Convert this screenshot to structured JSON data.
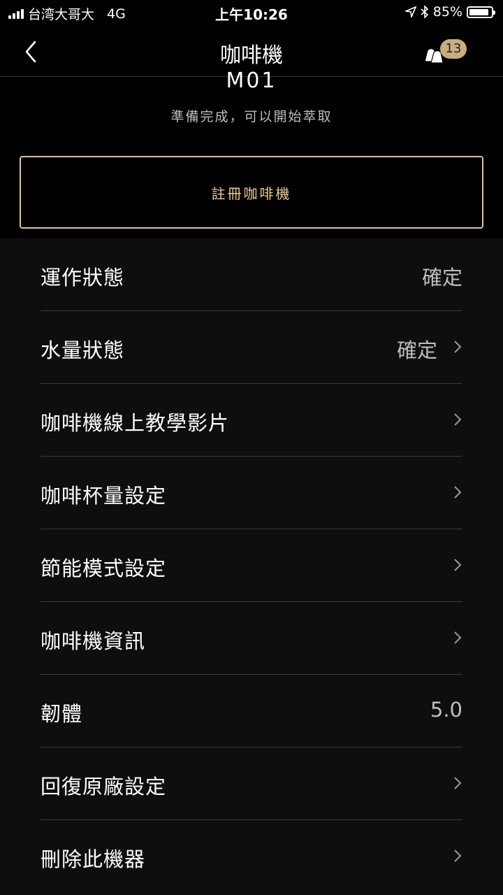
{
  "status_bar": {
    "carrier": "台湾大哥大",
    "network": "4G",
    "time": "上午10:26",
    "battery": "85%"
  },
  "nav": {
    "title": "咖啡機",
    "capsule_count": "13"
  },
  "machine": {
    "model": "M01",
    "status": "準備完成，可以開始萃取"
  },
  "register_button": "註冊咖啡機",
  "settings": [
    {
      "label": "運作狀態",
      "value": "確定",
      "chevron": false
    },
    {
      "label": "水量狀態",
      "value": "確定",
      "chevron": true
    },
    {
      "label": "咖啡機線上教學影片",
      "value": "",
      "chevron": true
    },
    {
      "label": "咖啡杯量設定",
      "value": "",
      "chevron": true
    },
    {
      "label": "節能模式設定",
      "value": "",
      "chevron": true
    },
    {
      "label": "咖啡機資訊",
      "value": "",
      "chevron": true
    },
    {
      "label": "韌體",
      "value": "5.0",
      "chevron": false
    },
    {
      "label": "回復原廠設定",
      "value": "",
      "chevron": true
    },
    {
      "label": "刪除此機器",
      "value": "",
      "chevron": true
    }
  ],
  "colors": {
    "accent": "#e1c48c",
    "badge": "#c8ad7f",
    "background": "#000000"
  }
}
